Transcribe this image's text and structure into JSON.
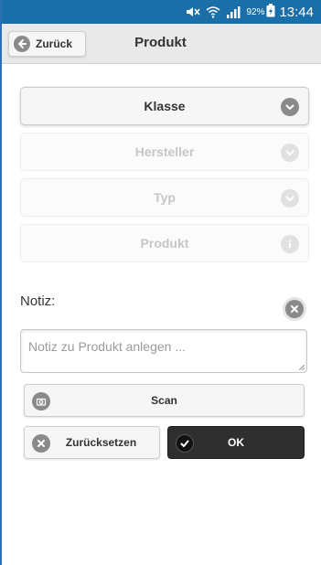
{
  "status_bar": {
    "battery_percent": "92%",
    "time": "13:44",
    "icons": [
      "mute-icon",
      "wifi-icon",
      "signal-icon",
      "battery-charging-icon"
    ],
    "color": "#1a6fa8"
  },
  "header": {
    "back_label": "Zurück",
    "title": "Produkt"
  },
  "selects": [
    {
      "label": "Klasse",
      "state": "active",
      "icon": "chevron-down-icon"
    },
    {
      "label": "Hersteller",
      "state": "disabled",
      "icon": "chevron-down-icon"
    },
    {
      "label": "Typ",
      "state": "disabled",
      "icon": "chevron-down-icon"
    },
    {
      "label": "Produkt",
      "state": "disabled",
      "icon": "info-icon"
    }
  ],
  "notiz": {
    "label": "Notiz:",
    "placeholder": "Notiz zu Produkt anlegen ..."
  },
  "buttons": {
    "scan": "Scan",
    "reset": "Zurücksetzen",
    "ok": "OK"
  }
}
